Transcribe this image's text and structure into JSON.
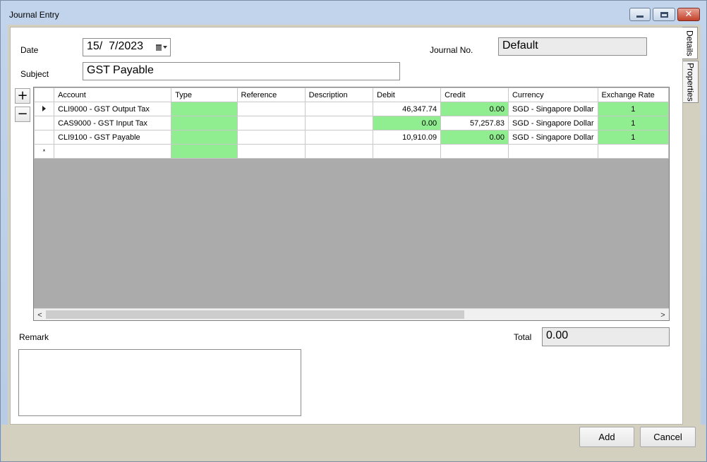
{
  "window": {
    "title": "Journal Entry"
  },
  "tabs": [
    "Details",
    "Properties"
  ],
  "form": {
    "date_label": "Date",
    "date_value": "15/  7/2023",
    "journal_no_label": "Journal No.",
    "journal_no_value": "Default",
    "subject_label": "Subject",
    "subject_value": "GST Payable",
    "remark_label": "Remark",
    "remark_value": "",
    "total_label": "Total",
    "total_value": "0.00"
  },
  "grid": {
    "columns": [
      "Account",
      "Type",
      "Reference",
      "Description",
      "Debit",
      "Credit",
      "Currency",
      "Exchange Rate"
    ],
    "rows": [
      {
        "account": "CLI9000 - GST Output Tax",
        "type": "",
        "reference": "",
        "description": "",
        "debit": "46,347.74",
        "credit": "0.00",
        "currency": "SGD - Singapore Dollar",
        "rate": "1"
      },
      {
        "account": "CAS9000 - GST Input Tax",
        "type": "",
        "reference": "",
        "description": "",
        "debit": "0.00",
        "credit": "57,257.83",
        "currency": "SGD - Singapore Dollar",
        "rate": "1"
      },
      {
        "account": "CLI9100 - GST Payable",
        "type": "",
        "reference": "",
        "description": "",
        "debit": "10,910.09",
        "credit": "0.00",
        "currency": "SGD - Singapore Dollar",
        "rate": "1"
      }
    ],
    "new_row_marker": "*"
  },
  "buttons": {
    "add_row": "+",
    "remove_row": "−",
    "add": "Add",
    "cancel": "Cancel"
  },
  "colors": {
    "highlight_cell": "#90ee90",
    "grid_empty_area": "#ababab"
  }
}
